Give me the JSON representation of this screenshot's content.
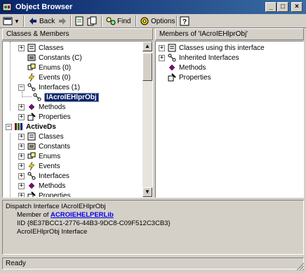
{
  "window": {
    "title": "Object Browser"
  },
  "toolbar": {
    "back": "Back",
    "find": "Find",
    "options": "Options"
  },
  "left": {
    "header": "Classes & Members",
    "items": [
      {
        "label": "Classes"
      },
      {
        "label": "Constants (C)"
      },
      {
        "label": "Enums (0)"
      },
      {
        "label": "Events (0)"
      },
      {
        "label": "Interfaces (1)"
      },
      {
        "label": "IAcroIEHlprObj"
      },
      {
        "label": "Methods"
      },
      {
        "label": "Properties"
      },
      {
        "label": "ActiveDs"
      },
      {
        "label": "Classes"
      },
      {
        "label": "Constants"
      },
      {
        "label": "Enums"
      },
      {
        "label": "Events"
      },
      {
        "label": "Interfaces"
      },
      {
        "label": "Methods"
      },
      {
        "label": "Properties"
      }
    ]
  },
  "right": {
    "header": "Members of 'IAcroIEHlprObj'",
    "items": [
      {
        "label": "Classes using this interface"
      },
      {
        "label": "Inherited Interfaces"
      },
      {
        "label": "Methods"
      },
      {
        "label": "Properties"
      }
    ]
  },
  "description": {
    "line1": "Dispatch Interface IAcroIEHlprObj",
    "member_prefix": "Member of ",
    "member_link": "ACROIEHELPERLib",
    "iid": "IID {8E37BCC1-2776-44B3-9DC8-C09F512C3CB3}",
    "line4": "AcroIEHlprObj Interface"
  },
  "status": {
    "text": "Ready"
  },
  "colors": {
    "title_start": "#0a246a",
    "title_end": "#3a6ea5",
    "selection": "#0a246a",
    "link": "#0000ee"
  }
}
